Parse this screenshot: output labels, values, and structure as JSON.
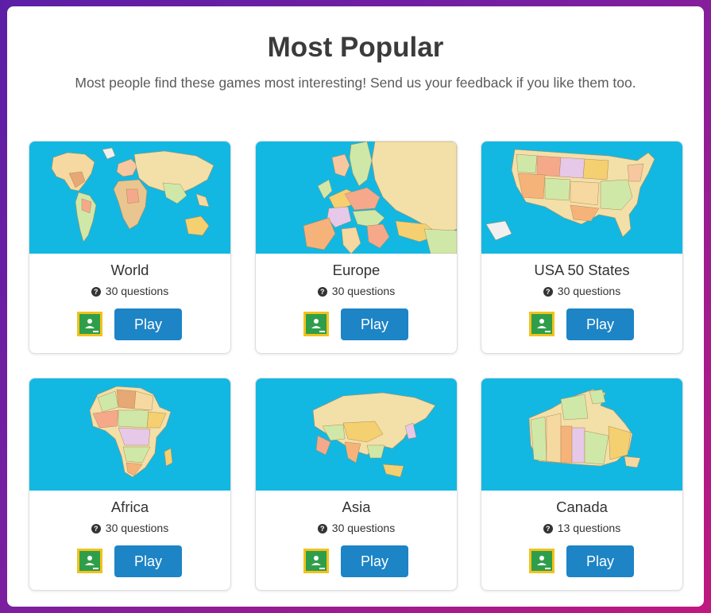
{
  "header": {
    "title": "Most Popular",
    "subtitle": "Most people find these games most interesting! Send us your feedback if you like them too."
  },
  "colors": {
    "map_background": "#12b8e2",
    "play_button": "#1d84c6",
    "classroom_green": "#2f9e4a",
    "classroom_border": "#f2c21b"
  },
  "cards": [
    {
      "name": "World",
      "questions": "30 questions",
      "play_label": "Play",
      "map_icon": "world-map-icon"
    },
    {
      "name": "Europe",
      "questions": "30 questions",
      "play_label": "Play",
      "map_icon": "europe-map-icon"
    },
    {
      "name": "USA 50 States",
      "questions": "30 questions",
      "play_label": "Play",
      "map_icon": "usa-map-icon"
    },
    {
      "name": "Africa",
      "questions": "30 questions",
      "play_label": "Play",
      "map_icon": "africa-map-icon"
    },
    {
      "name": "Asia",
      "questions": "30 questions",
      "play_label": "Play",
      "map_icon": "asia-map-icon"
    },
    {
      "name": "Canada",
      "questions": "13 questions",
      "play_label": "Play",
      "map_icon": "canada-map-icon"
    }
  ]
}
